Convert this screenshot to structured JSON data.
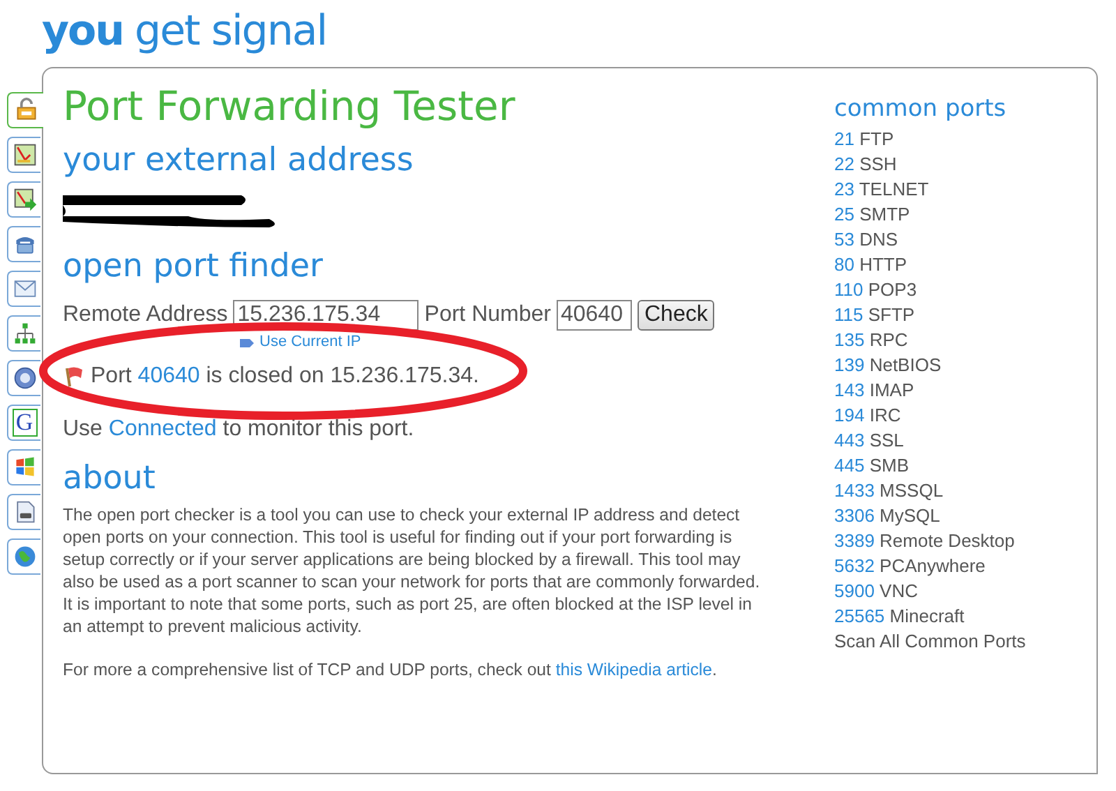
{
  "logo": {
    "first": "you",
    "rest": "get signal"
  },
  "side_tabs": [
    {
      "selected": true
    },
    {
      "selected": false
    },
    {
      "selected": false
    },
    {
      "selected": false
    },
    {
      "selected": false
    },
    {
      "selected": false
    },
    {
      "selected": false
    },
    {
      "glyph": "G",
      "selected": false
    },
    {
      "selected": false
    },
    {
      "selected": false
    },
    {
      "selected": false
    }
  ],
  "title": "Port Forwarding Tester",
  "external_heading": "your external address",
  "finder_heading": "open port finder",
  "form": {
    "address_label": "Remote Address",
    "address_value": "15.236.175.34",
    "port_label": "Port Number",
    "port_value": "40640",
    "button": "Check",
    "use_ip_link": "Use Current IP"
  },
  "result": {
    "prefix": "Port",
    "port": "40640",
    "suffix": "is closed on 15.236.175.34."
  },
  "monitor": {
    "prefix": "Use",
    "link": "Connected",
    "suffix": "to monitor this port."
  },
  "about_heading": "about",
  "about_text": "The open port checker is a tool you can use to check your external IP address and detect open ports on your connection. This tool is useful for finding out if your port forwarding is setup correctly or if your server applications are being blocked by a firewall. This tool may also be used as a port scanner to scan your network for ports that are commonly forwarded. It is important to note that some ports, such as port 25, are often blocked at the ISP level in an attempt to prevent malicious activity.",
  "footer": {
    "text": "For more a comprehensive list of TCP and UDP ports, check out",
    "link": "this Wikipedia article",
    "end": "."
  },
  "common_ports": {
    "heading": "common ports",
    "items": [
      {
        "port": "21",
        "name": "FTP"
      },
      {
        "port": "22",
        "name": "SSH"
      },
      {
        "port": "23",
        "name": "TELNET"
      },
      {
        "port": "25",
        "name": "SMTP"
      },
      {
        "port": "53",
        "name": "DNS"
      },
      {
        "port": "80",
        "name": "HTTP"
      },
      {
        "port": "110",
        "name": "POP3"
      },
      {
        "port": "115",
        "name": "SFTP"
      },
      {
        "port": "135",
        "name": "RPC"
      },
      {
        "port": "139",
        "name": "NetBIOS"
      },
      {
        "port": "143",
        "name": "IMAP"
      },
      {
        "port": "194",
        "name": "IRC"
      },
      {
        "port": "443",
        "name": "SSL"
      },
      {
        "port": "445",
        "name": "SMB"
      },
      {
        "port": "1433",
        "name": "MSSQL"
      },
      {
        "port": "3306",
        "name": "MySQL"
      },
      {
        "port": "3389",
        "name": "Remote Desktop"
      },
      {
        "port": "5632",
        "name": "PCAnywhere"
      },
      {
        "port": "5900",
        "name": "VNC"
      },
      {
        "port": "25565",
        "name": "Minecraft"
      }
    ],
    "scan_all": "Scan All Common Ports"
  }
}
